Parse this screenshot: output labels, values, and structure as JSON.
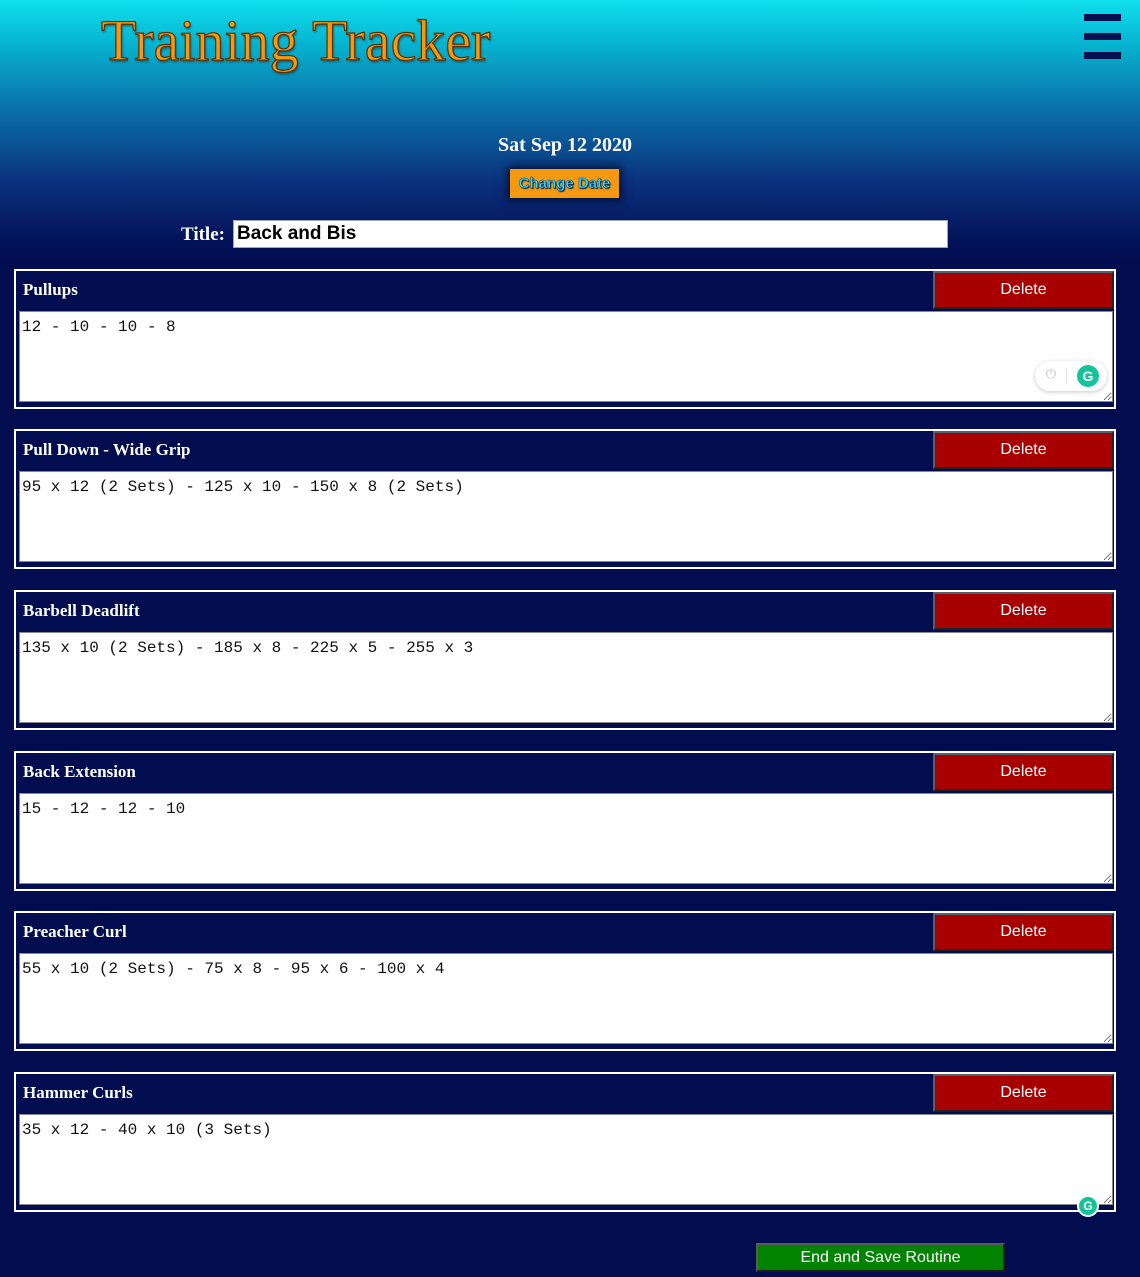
{
  "app": {
    "title": "Training Tracker"
  },
  "header": {
    "date": "Sat Sep 12 2020",
    "change_date_label": "Change Date"
  },
  "routine": {
    "title_label": "Title:",
    "title_value": "Back and Bis"
  },
  "exercises": [
    {
      "name": "Pullups",
      "notes": "12 - 10 - 10 - 8",
      "delete_label": "Delete"
    },
    {
      "name": "Pull Down - Wide Grip",
      "notes": "95 x 12 (2 Sets) - 125 x 10 - 150 x 8 (2 Sets)",
      "delete_label": "Delete"
    },
    {
      "name": "Barbell Deadlift",
      "notes": "135 x 10 (2 Sets) - 185 x 8 - 225 x 5 - 255 x 3",
      "delete_label": "Delete"
    },
    {
      "name": "Back Extension",
      "notes": "15 - 12 - 12 - 10",
      "delete_label": "Delete"
    },
    {
      "name": "Preacher Curl",
      "notes": "55 x 10 (2 Sets) - 75 x 8 - 95 x 6 - 100 x 4",
      "delete_label": "Delete"
    },
    {
      "name": "Hammer Curls",
      "notes": "35 x 12 - 40 x 10 (3 Sets)",
      "delete_label": "Delete"
    }
  ],
  "footer": {
    "save_label": "End and Save Routine"
  },
  "icons": {
    "menu": "hamburger-menu-icon",
    "grammarly": "grammarly-icon",
    "grammarly_letter": "G",
    "power": "power-icon",
    "power_glyph": "⏻"
  },
  "colors": {
    "title_orange": "#f59a10",
    "navy": "#020d4f",
    "delete_red": "#a80000",
    "save_green": "#008300",
    "cyan_top": "#10e0ee"
  }
}
